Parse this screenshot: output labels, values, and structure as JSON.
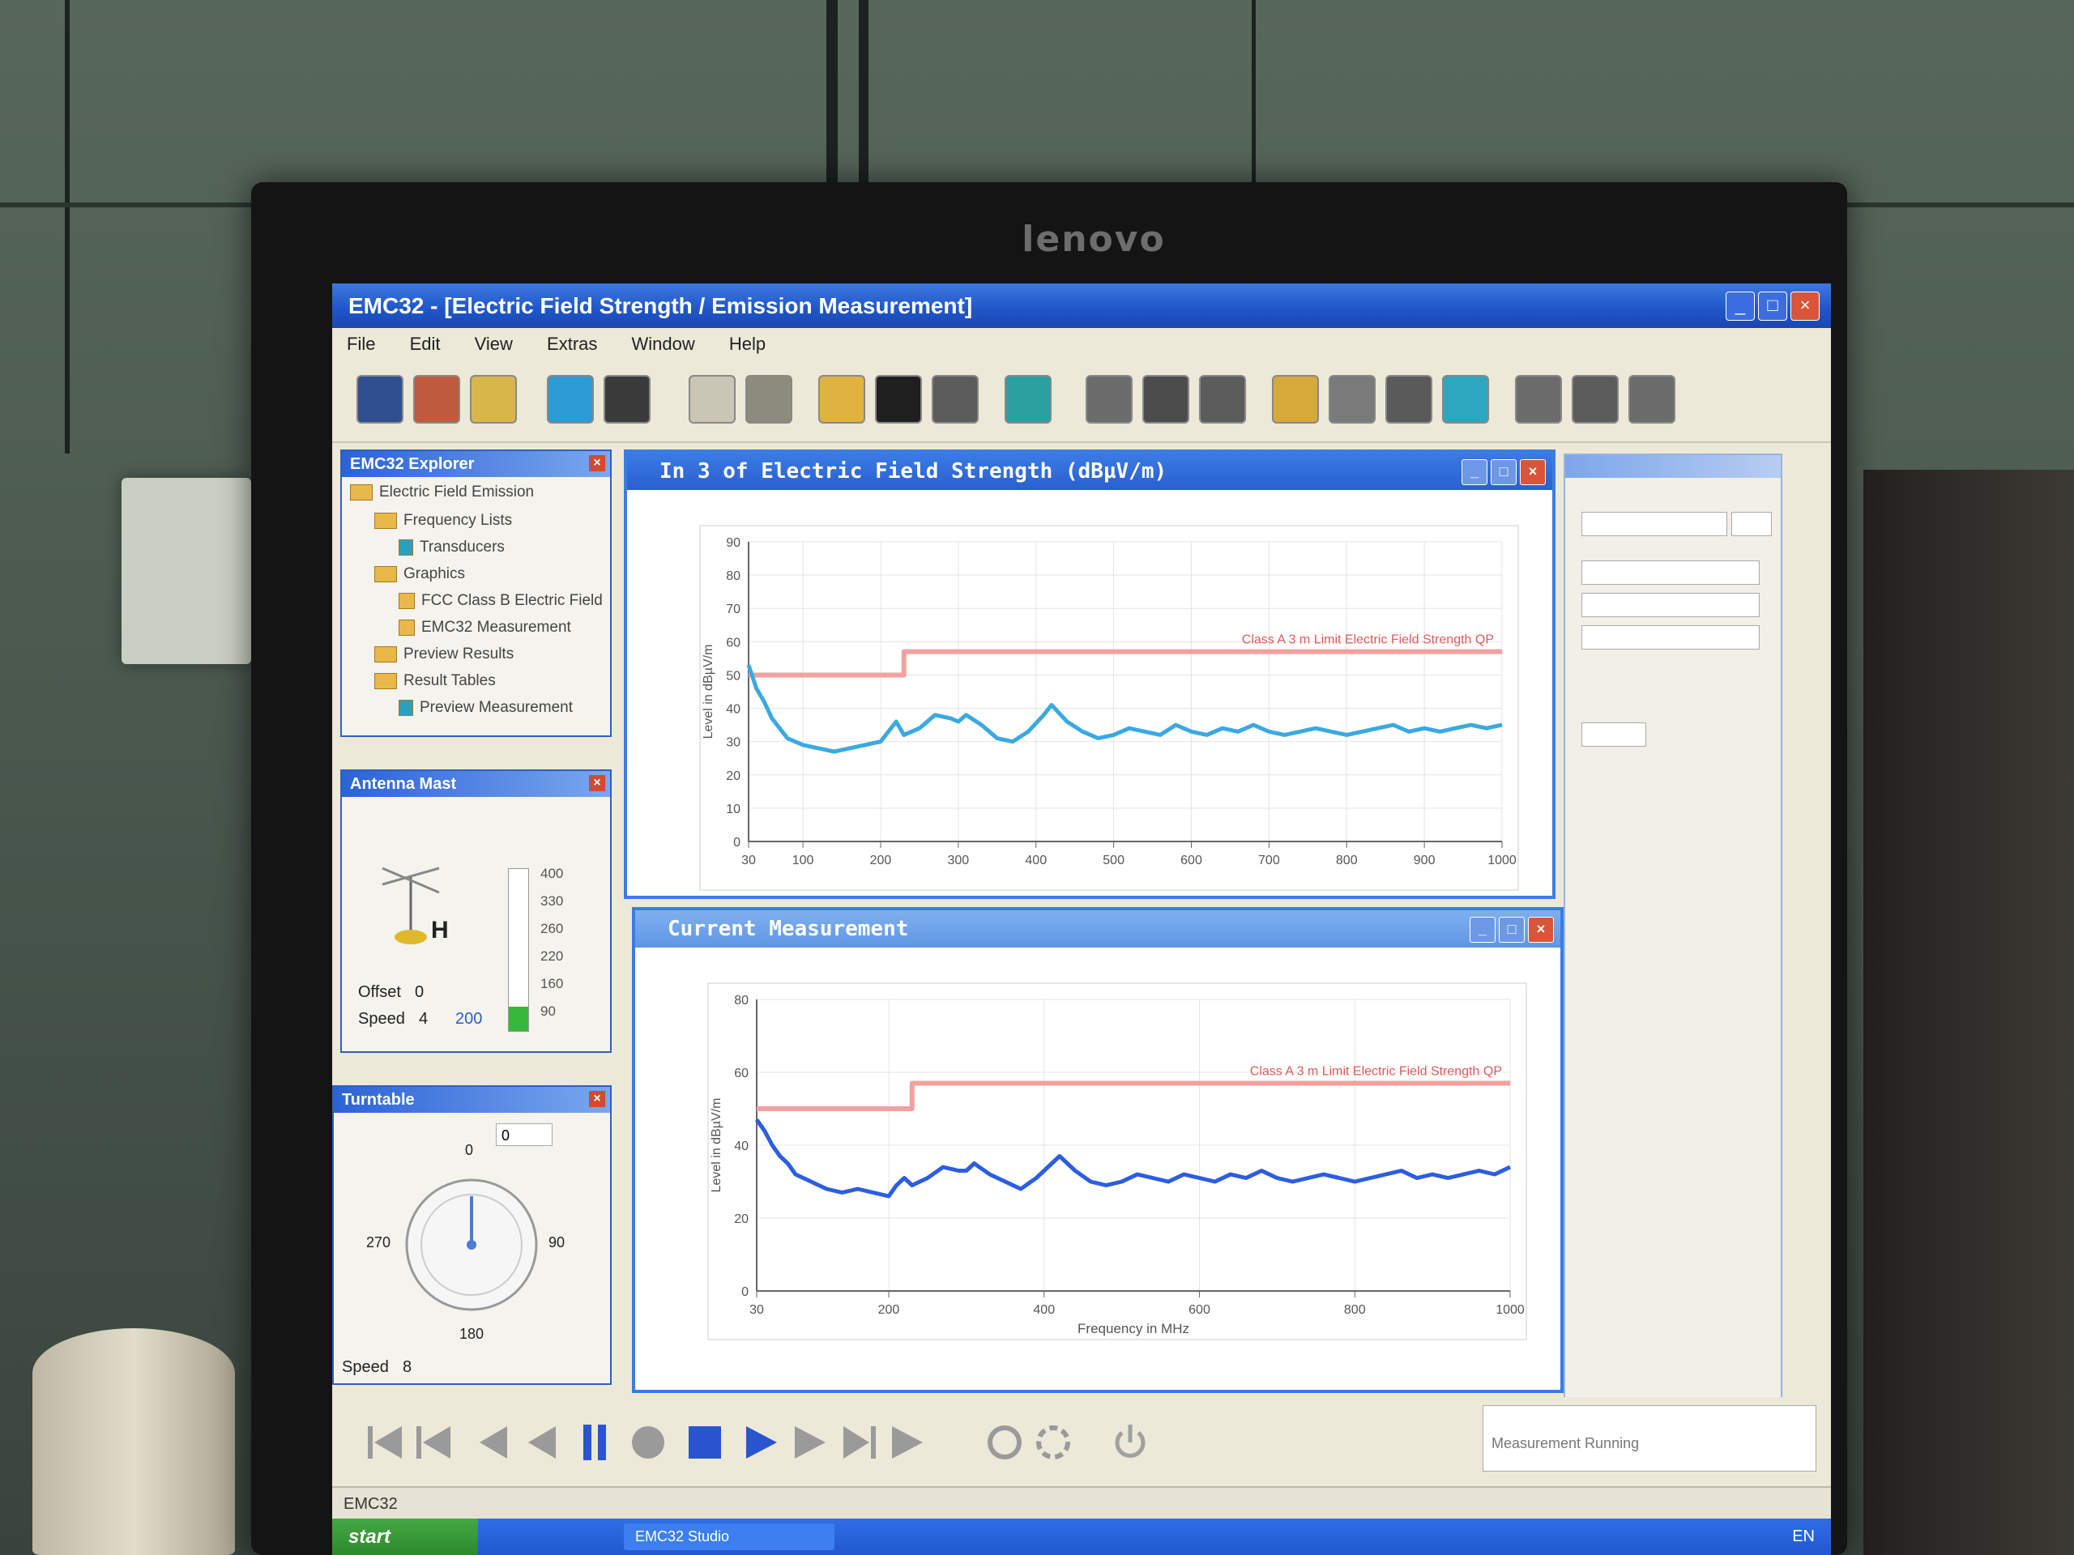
{
  "monitor": {
    "brand": "lenovo"
  },
  "app": {
    "title": "EMC32 - [Electric Field Strength / Emission Measurement]",
    "menu": [
      "File",
      "Edit",
      "View",
      "Extras",
      "Window",
      "Help"
    ]
  },
  "toolbar": {
    "icons": [
      "new-icon",
      "open-icon",
      "wizard-icon",
      "network-icon",
      "monitor-icon",
      "print-preview-icon",
      "tools-icon",
      "folder-icon",
      "film-icon",
      "printer-icon",
      "device-icon",
      "test-1-icon",
      "test-2-icon",
      "test-3-icon",
      "wizard-2-icon",
      "probe-icon",
      "report-icon",
      "export-icon",
      "test-4-icon",
      "test-5-icon",
      "test-6-icon"
    ]
  },
  "tree_panel": {
    "title": "EMC32 Explorer",
    "items": [
      "Electric Field Emission",
      "Frequency Lists",
      "Transducers",
      "Graphics",
      "FCC Class B Electric Field",
      "EMC32 Measurement",
      "Preview Results",
      "Result Tables",
      "Preview Measurement"
    ]
  },
  "antenna_panel": {
    "title": "Antenna Mast",
    "polarization": "H",
    "offset_label": "Offset",
    "offset_value": "0",
    "speed_label": "Speed",
    "speed_value": "4",
    "speed_extra": "200",
    "scale": [
      "400",
      "330",
      "260",
      "220",
      "160",
      "90"
    ],
    "level_fraction": 0.15
  },
  "turntable_panel": {
    "title": "Turntable",
    "dial_labels": [
      "0",
      "90",
      "180",
      "270"
    ],
    "angle_value": "0",
    "speed_label": "Speed",
    "speed_value": "8"
  },
  "chart1": {
    "window_title": "In 3 of Electric Field Strength (dBµV/m)",
    "limit_label": "Class A 3 m Limit Electric Field Strength QP",
    "ylabel": "Level in dBµV/m",
    "xlabel": ""
  },
  "chart2": {
    "window_title": "Current Measurement",
    "limit_label": "Class A 3 m Limit Electric Field Strength QP",
    "ylabel": "Level in dBµV/m",
    "xlabel": "Frequency in MHz"
  },
  "chart_data": [
    {
      "type": "line",
      "title": "",
      "xlabel": "",
      "ylabel": "Level in dBµV/m",
      "xlim": [
        30,
        1000
      ],
      "ylim": [
        0,
        90
      ],
      "xticks": [
        "30",
        "100",
        "200",
        "300",
        "400",
        "500",
        "600",
        "700",
        "800",
        "900",
        "1000"
      ],
      "yticks": [
        "0",
        "10",
        "20",
        "30",
        "40",
        "50",
        "60",
        "70",
        "80",
        "90"
      ],
      "grid": true,
      "series": [
        {
          "name": "Class A 3 m Limit Electric Field Strength QP",
          "color": "#f2a0a0",
          "x": [
            30,
            230,
            230,
            1000
          ],
          "y": [
            50,
            50,
            57,
            57
          ]
        },
        {
          "name": "",
          "color": "#3aa9e2",
          "x": [
            30,
            40,
            50,
            60,
            70,
            80,
            90,
            100,
            120,
            140,
            160,
            180,
            200,
            210,
            220,
            230,
            250,
            270,
            290,
            300,
            310,
            330,
            350,
            370,
            390,
            410,
            420,
            440,
            460,
            480,
            500,
            520,
            540,
            560,
            580,
            600,
            620,
            640,
            660,
            680,
            700,
            720,
            740,
            760,
            780,
            800,
            820,
            840,
            860,
            880,
            900,
            920,
            940,
            960,
            980,
            1000
          ],
          "y": [
            53,
            46,
            42,
            37,
            34,
            31,
            30,
            29,
            28,
            27,
            28,
            29,
            30,
            33,
            36,
            32,
            34,
            38,
            37,
            36,
            38,
            35,
            31,
            30,
            33,
            38,
            41,
            36,
            33,
            31,
            32,
            34,
            33,
            32,
            35,
            33,
            32,
            34,
            33,
            35,
            33,
            32,
            33,
            34,
            33,
            32,
            33,
            34,
            35,
            33,
            34,
            33,
            34,
            35,
            34,
            35
          ]
        }
      ]
    },
    {
      "type": "line",
      "title": "",
      "xlabel": "Frequency in MHz",
      "ylabel": "Level in dBµV/m",
      "xlim": [
        30,
        1000
      ],
      "ylim": [
        0,
        80
      ],
      "xticks": [
        "30",
        "200",
        "400",
        "600",
        "800",
        "1000"
      ],
      "yticks": [
        "0",
        "20",
        "40",
        "60",
        "80"
      ],
      "grid": true,
      "series": [
        {
          "name": "Class A 3 m Limit Electric Field Strength QP",
          "color": "#f2a0a0",
          "x": [
            30,
            230,
            230,
            1000
          ],
          "y": [
            50,
            50,
            57,
            57
          ]
        },
        {
          "name": "",
          "color": "#2c5de3",
          "x": [
            30,
            40,
            50,
            60,
            70,
            80,
            90,
            100,
            120,
            140,
            160,
            180,
            200,
            210,
            220,
            230,
            250,
            270,
            290,
            300,
            310,
            330,
            350,
            370,
            390,
            410,
            420,
            440,
            460,
            480,
            500,
            520,
            540,
            560,
            580,
            600,
            620,
            640,
            660,
            680,
            700,
            720,
            740,
            760,
            780,
            800,
            820,
            840,
            860,
            880,
            900,
            920,
            940,
            960,
            980,
            1000
          ],
          "y": [
            47,
            44,
            40,
            37,
            35,
            32,
            31,
            30,
            28,
            27,
            28,
            27,
            26,
            29,
            31,
            29,
            31,
            34,
            33,
            33,
            35,
            32,
            30,
            28,
            31,
            35,
            37,
            33,
            30,
            29,
            30,
            32,
            31,
            30,
            32,
            31,
            30,
            32,
            31,
            33,
            31,
            30,
            31,
            32,
            31,
            30,
            31,
            32,
            33,
            31,
            32,
            31,
            32,
            33,
            32,
            34
          ]
        }
      ]
    }
  ],
  "status_bar": {
    "text": "EMC32"
  },
  "info_box": {
    "text": "Measurement Running"
  },
  "taskbar": {
    "start": "start",
    "task": "EMC32 Studio",
    "clock": "EN"
  }
}
